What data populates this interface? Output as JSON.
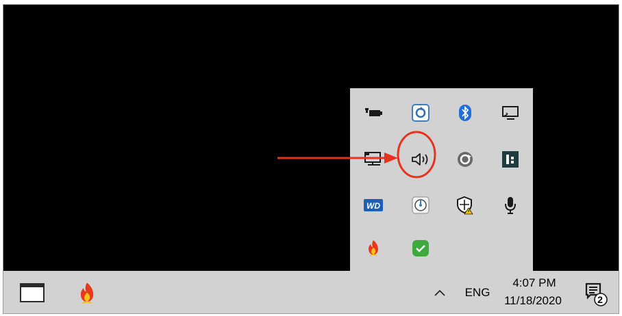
{
  "tray_overflow": {
    "icons": [
      {
        "name": "battery-power-icon"
      },
      {
        "name": "cloud-sync-icon"
      },
      {
        "name": "bluetooth-icon"
      },
      {
        "name": "display-projection-icon"
      },
      {
        "name": "network-icon"
      },
      {
        "name": "speaker-volume-icon"
      },
      {
        "name": "update-refresh-icon"
      },
      {
        "name": "dark-app-icon"
      },
      {
        "name": "wd-icon",
        "label": "WD"
      },
      {
        "name": "disk-utility-icon"
      },
      {
        "name": "security-shield-icon"
      },
      {
        "name": "microphone-icon"
      },
      {
        "name": "flame-app-icon"
      },
      {
        "name": "green-check-app-icon"
      }
    ]
  },
  "taskbar": {
    "task_view_icon": "task-view-icon",
    "app_icon": "flame-app-icon",
    "chevron_icon": "chevron-up-icon",
    "language": "ENG",
    "time": "4:07 PM",
    "date": "11/18/2020",
    "notification_count": "2"
  },
  "annotation": {
    "arrow_color": "#e8321e",
    "circle_color": "#e8321e"
  }
}
